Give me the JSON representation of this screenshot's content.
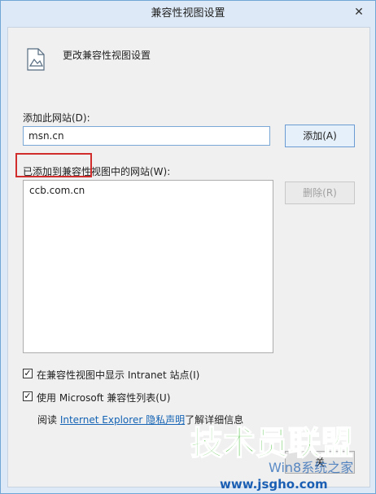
{
  "window": {
    "title": "兼容性视图设置",
    "close_glyph": "✕"
  },
  "header": {
    "title": "更改兼容性视图设置",
    "icon": "image-file-icon"
  },
  "add_site": {
    "label": "添加此网站(D):",
    "input_value": "msn.cn",
    "add_button": "添加(A)"
  },
  "sites_list": {
    "label": "已添加到兼容性视图中的网站(W):",
    "items": [
      "ccb.com.cn"
    ],
    "remove_button": "删除(R)"
  },
  "options": {
    "intranet": {
      "label": "在兼容性视图中显示 Intranet 站点(I)",
      "checked": true
    },
    "ms_list": {
      "label": "使用 Microsoft 兼容性列表(U)",
      "checked": true
    }
  },
  "privacy": {
    "prefix": "阅读 ",
    "link": "Internet Explorer 隐私声明",
    "suffix": "了解详细信息"
  },
  "close_button": {
    "label": "关"
  },
  "watermark": {
    "title": "技术员联盟",
    "url": "www.jsgho.com",
    "overlay": "Win8系统之家"
  },
  "colors": {
    "highlight": "#d12d2d",
    "link": "#1463b4",
    "watermark_green": "#2fb51f",
    "watermark_blue": "#1a5fb4"
  }
}
